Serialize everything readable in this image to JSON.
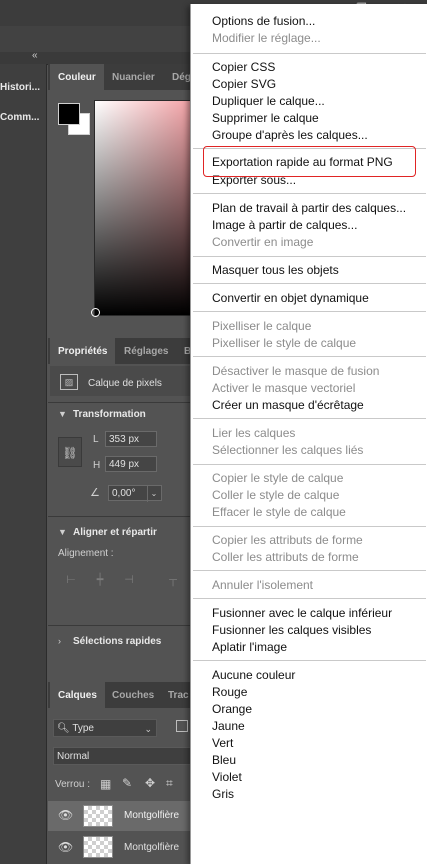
{
  "left_panel": {
    "items": [
      "Histori...",
      "Comm..."
    ]
  },
  "color_panel": {
    "tabs": [
      "Couleur",
      "Nuancier",
      "Dég"
    ]
  },
  "properties_panel": {
    "tabs": [
      "Propriétés",
      "Réglages",
      "B"
    ],
    "layer_type": "Calque de pixels",
    "transform": {
      "title": "Transformation",
      "w_label": "L",
      "w_value": "353 px",
      "h_label": "H",
      "h_value": "449 px",
      "angle_value": "0,00°"
    },
    "align": {
      "title": "Aligner et répartir",
      "label": "Alignement :"
    },
    "quick": {
      "title": "Sélections rapides"
    }
  },
  "layers_panel": {
    "tabs": [
      "Calques",
      "Couches",
      "Trac"
    ],
    "filter_value": "Type",
    "blend_mode": "Normal",
    "lock_label": "Verrou :",
    "layers": [
      {
        "name": "Montgolfière",
        "visible": true,
        "selected": true
      },
      {
        "name": "Montgolfière",
        "visible": true,
        "selected": false
      }
    ]
  },
  "context_menu": {
    "groups": [
      [
        {
          "label": "Options de fusion...",
          "enabled": true
        },
        {
          "label": "Modifier le réglage...",
          "enabled": false
        }
      ],
      [
        {
          "label": "Copier CSS",
          "enabled": true
        },
        {
          "label": "Copier SVG",
          "enabled": true
        },
        {
          "label": "Dupliquer le calque...",
          "enabled": true
        },
        {
          "label": "Supprimer le calque",
          "enabled": true
        },
        {
          "label": "Groupe d'après les calques...",
          "enabled": true
        }
      ],
      [
        {
          "label": "Exportation rapide au format PNG",
          "enabled": true
        },
        {
          "label": "Exporter sous...",
          "enabled": true
        }
      ],
      [
        {
          "label": "Plan de travail à partir des calques...",
          "enabled": true
        },
        {
          "label": "Image à partir de calques...",
          "enabled": true
        },
        {
          "label": "Convertir en image",
          "enabled": false
        }
      ],
      [
        {
          "label": "Masquer tous les objets",
          "enabled": true
        }
      ],
      [
        {
          "label": "Convertir en objet dynamique",
          "enabled": true
        }
      ],
      [
        {
          "label": "Pixelliser le calque",
          "enabled": false
        },
        {
          "label": "Pixelliser le style de calque",
          "enabled": false
        }
      ],
      [
        {
          "label": "Désactiver le masque de fusion",
          "enabled": false
        },
        {
          "label": "Activer le masque vectoriel",
          "enabled": false
        },
        {
          "label": "Créer un masque d'écrêtage",
          "enabled": true
        }
      ],
      [
        {
          "label": "Lier les calques",
          "enabled": false
        },
        {
          "label": "Sélectionner les calques liés",
          "enabled": false
        }
      ],
      [
        {
          "label": "Copier le style de calque",
          "enabled": false
        },
        {
          "label": "Coller le style de calque",
          "enabled": false
        },
        {
          "label": "Effacer le style de calque",
          "enabled": false
        }
      ],
      [
        {
          "label": "Copier les attributs de forme",
          "enabled": false
        },
        {
          "label": "Coller les attributs de forme",
          "enabled": false
        }
      ],
      [
        {
          "label": "Annuler l'isolement",
          "enabled": false
        }
      ],
      [
        {
          "label": "Fusionner avec le calque inférieur",
          "enabled": true
        },
        {
          "label": "Fusionner les calques visibles",
          "enabled": true
        },
        {
          "label": "Aplatir l'image",
          "enabled": true
        }
      ],
      [
        {
          "label": "Aucune couleur",
          "enabled": true
        },
        {
          "label": "Rouge",
          "enabled": true
        },
        {
          "label": "Orange",
          "enabled": true
        },
        {
          "label": "Jaune",
          "enabled": true
        },
        {
          "label": "Vert",
          "enabled": true
        },
        {
          "label": "Bleu",
          "enabled": true
        },
        {
          "label": "Violet",
          "enabled": true
        },
        {
          "label": "Gris",
          "enabled": true
        }
      ]
    ],
    "highlighted_item": "Exportation rapide au format PNG",
    "highlight_color": "#e02424"
  },
  "window_controls": [
    "minimize-icon",
    "restore-icon",
    "close-icon"
  ]
}
